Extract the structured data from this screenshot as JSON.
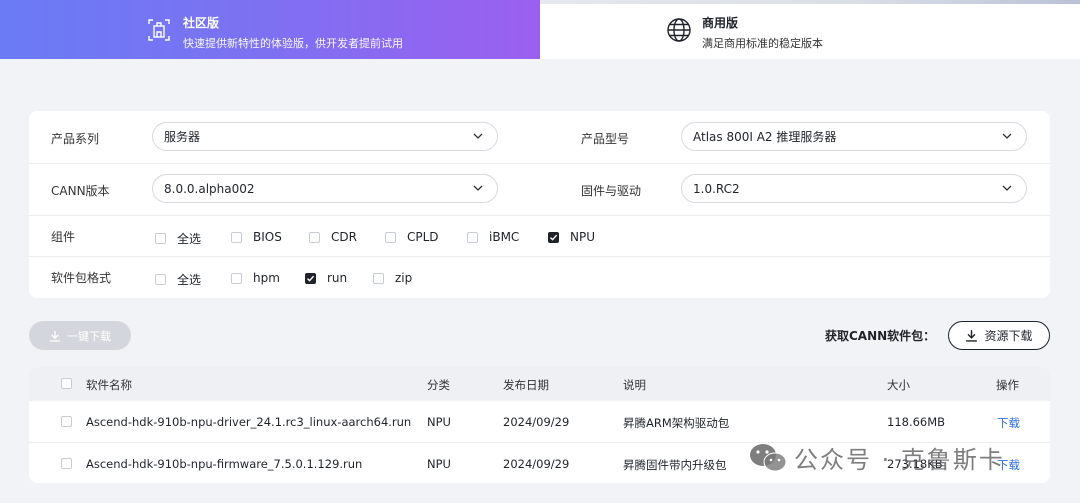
{
  "tabs": {
    "community": {
      "title": "社区版",
      "desc": "快速提供新特性的体验版，供开发者提前试用"
    },
    "commercial": {
      "title": "商用版",
      "desc": "满足商用标准的稳定版本"
    }
  },
  "filters": {
    "product_series": {
      "label": "产品系列",
      "value": "服务器"
    },
    "product_model": {
      "label": "产品型号",
      "value": "Atlas 800I A2 推理服务器"
    },
    "cann_version": {
      "label": "CANN版本",
      "value": "8.0.0.alpha002"
    },
    "firmware_driver": {
      "label": "固件与驱动",
      "value": "1.0.RC2"
    },
    "components": {
      "label": "组件",
      "options": [
        {
          "label": "全选",
          "checked": false
        },
        {
          "label": "BIOS",
          "checked": false
        },
        {
          "label": "CDR",
          "checked": false
        },
        {
          "label": "CPLD",
          "checked": false
        },
        {
          "label": "iBMC",
          "checked": false
        },
        {
          "label": "NPU",
          "checked": true
        }
      ]
    },
    "package_format": {
      "label": "软件包格式",
      "options": [
        {
          "label": "全选",
          "checked": false
        },
        {
          "label": "hpm",
          "checked": false
        },
        {
          "label": "run",
          "checked": true
        },
        {
          "label": "zip",
          "checked": false
        }
      ]
    }
  },
  "actions": {
    "one_click_download": "一键下载",
    "get_package_label": "获取CANN软件包：",
    "resource_download": "资源下载"
  },
  "table": {
    "headers": [
      "软件名称",
      "分类",
      "发布日期",
      "说明",
      "大小",
      "操作"
    ],
    "rows": [
      {
        "name": "Ascend-hdk-910b-npu-driver_24.1.rc3_linux-aarch64.run",
        "category": "NPU",
        "date": "2024/09/29",
        "desc": "昇腾ARM架构驱动包",
        "size": "118.66MB",
        "action": "下载"
      },
      {
        "name": "Ascend-hdk-910b-npu-firmware_7.5.0.1.129.run",
        "category": "NPU",
        "date": "2024/09/29",
        "desc": "昇腾固件带内升级包",
        "size": "273.18KB",
        "action": "下载"
      }
    ]
  },
  "watermark": {
    "text": "公众号 · 克鲁斯卡"
  }
}
